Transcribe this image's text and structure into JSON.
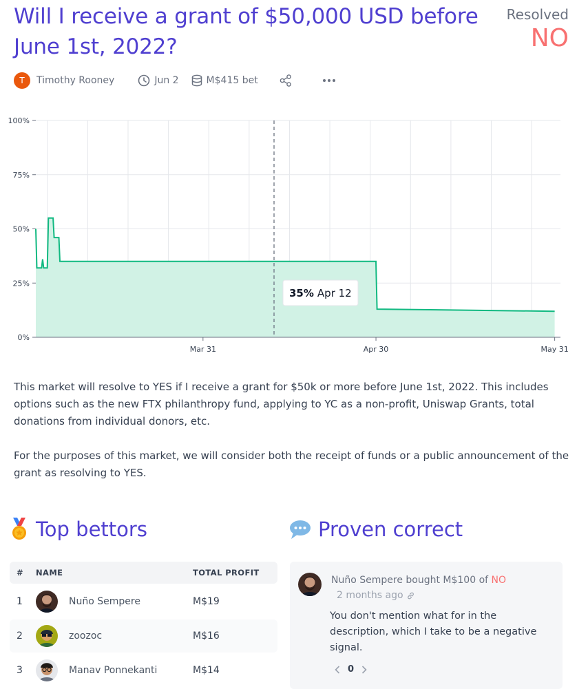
{
  "market": {
    "title": "Will I receive a grant of $50,000 USD before June 1st, 2022?",
    "resolved_label": "Resolved",
    "resolution": "NO",
    "creator_initial": "T",
    "creator_name": "Timothy Rooney",
    "close_date": "Jun 2",
    "volume": "M$415 bet",
    "icons": [
      "clock-icon",
      "database-icon",
      "share-icon",
      "more-icon"
    ],
    "colors": {
      "accent": "#4f3fd0",
      "no": "#f87171",
      "line": "#11b981",
      "area": "#d1f2e5"
    }
  },
  "chart_data": {
    "type": "area",
    "ylim": [
      0,
      100
    ],
    "y_ticks": [
      "0%",
      "25%",
      "50%",
      "75%",
      "100%"
    ],
    "x_ticks": [
      "Mar 31",
      "Apr 30",
      "May 31"
    ],
    "series": [
      {
        "x": [
          "Mar 2",
          "Mar 2",
          "Mar 3",
          "Mar 3",
          "Mar 3",
          "Mar 4",
          "Mar 4",
          "Mar 4",
          "Mar 5",
          "Mar 5",
          "Mar 6",
          "Mar 6",
          "Apr 30",
          "Apr 30",
          "May 31"
        ],
        "values": [
          50,
          32,
          32,
          36,
          32,
          32,
          55,
          55,
          55,
          46,
          46,
          35,
          35,
          13,
          12
        ]
      }
    ],
    "tooltip": {
      "value": "35%",
      "date": "Apr 12"
    }
  },
  "description": {
    "p1": "This market will resolve to YES if I receive a grant for $50k or more before June 1st, 2022. This includes options such as the new FTX philanthropy fund, applying to YC as a non-profit, Uniswap Grants, total donations from individual donors, etc.",
    "p2": "For the purposes of this market, we will consider both the receipt of funds or a public announcement of the grant as resolving to YES."
  },
  "top_bettors": {
    "title": "Top bettors",
    "col_rank": "#",
    "col_name": "NAME",
    "col_profit": "TOTAL PROFIT",
    "rows": [
      {
        "rank": "1",
        "name": "Nuño Sempere",
        "profit": "M$19"
      },
      {
        "rank": "2",
        "name": "zoozoc",
        "profit": "M$16"
      },
      {
        "rank": "3",
        "name": "Manav Ponnekanti",
        "profit": "M$14"
      }
    ]
  },
  "proven_correct": {
    "title": "Proven correct",
    "author_action": "Nuño Sempere bought M$100 of ",
    "outcome": "NO",
    "time": "2 months ago",
    "text": "You don't mention what for in the description, which I take to be a negative signal.",
    "votes": "0"
  }
}
